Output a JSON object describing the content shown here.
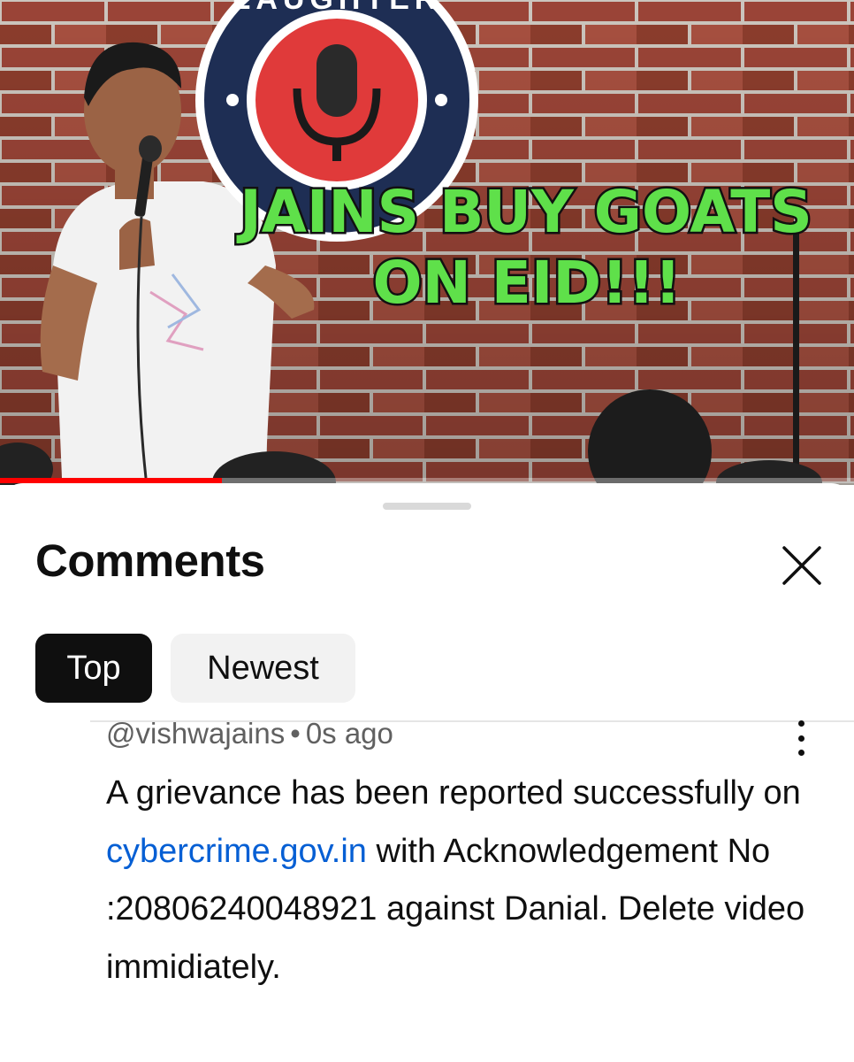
{
  "video": {
    "thumbnail_text_line1": "JAINS BUY GOATS",
    "thumbnail_text_line2": "ON EID!!!",
    "logo_text": "LAUGHTER",
    "progress_percent": 26
  },
  "comments_panel": {
    "title": "Comments",
    "close_icon": "close-icon",
    "filters": [
      {
        "label": "Top",
        "selected": true
      },
      {
        "label": "Newest",
        "selected": false
      }
    ]
  },
  "comment": {
    "author": "@vishwajains",
    "separator": "•",
    "time": "0s ago",
    "text_part1": "A grievance has been reported successfully on ",
    "link_text": "cybercrime.gov.in",
    "text_part2": " with Acknowledgement No :20806240048921 against Danial. Delete video immidiately.",
    "menu_icon": "more-vertical-icon"
  },
  "colors": {
    "accent_link": "#065fd4",
    "progress": "#ff0000",
    "chip_selected_bg": "#0f0f0f",
    "chip_bg": "#f2f2f2",
    "thumbnail_text": "#5fe04a"
  }
}
